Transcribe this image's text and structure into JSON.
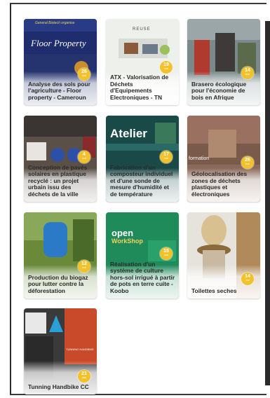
{
  "cards": [
    {
      "title": "Analyse des sols pour l'agriculture - Floor property - Cameroun",
      "badge": "26",
      "thumb_text_a": "General Biotech organise",
      "thumb_text_b": "Floor Property"
    },
    {
      "title": "ATX - Valorisation de Déchets d'Equipements Electroniques - TN",
      "badge": "19",
      "thumb_text_a": "REUSE"
    },
    {
      "title": "Brasero écologique pour l'économie de bois en Afrique",
      "badge": "14"
    },
    {
      "title": "Conception de pavés solaires en plastique recyclé : un projet urbain issu des déchets de la ville",
      "badge": "4"
    },
    {
      "title": "Fabrication d'un composteur individuel et d'une sonde de mesure d'humidité et de température",
      "badge": "17",
      "thumb_text_a": "Atelier"
    },
    {
      "title": "Géolocalisation des zones de déchets plastiques et électroniques",
      "badge": "26",
      "thumb_text_a": "formation"
    },
    {
      "title": "Production du biogaz pour lutter contre la déforestation",
      "badge": "12"
    },
    {
      "title": "Réalisation d'un système de culture hors-sol irrigué à partir de pots en terre cuite - Koobo",
      "badge": "15",
      "thumb_text_a": "open",
      "thumb_text_b": "WorkShop"
    },
    {
      "title": "Toilettes seches",
      "badge": "14"
    },
    {
      "title": "Tunning Handbike CC",
      "badge": "21",
      "thumb_text_a": "TUNNING HANDBIKE"
    }
  ],
  "badge_sub": "mai",
  "colors": {
    "badge": "#f3c22a",
    "frame": "#2b2b2b"
  }
}
